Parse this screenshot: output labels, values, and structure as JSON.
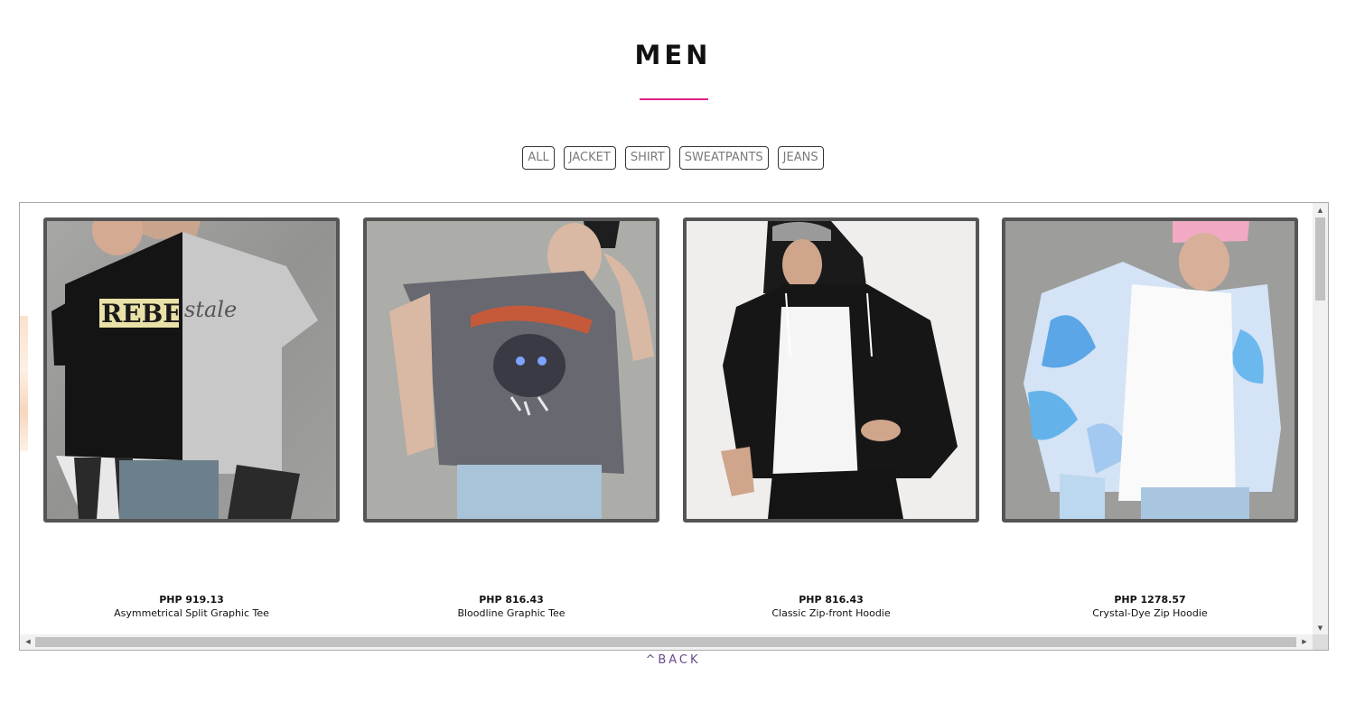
{
  "page": {
    "title": "MEN",
    "accent_color": "#e0218a"
  },
  "filters": [
    {
      "label": "ALL"
    },
    {
      "label": "JACKET"
    },
    {
      "label": "SHIRT"
    },
    {
      "label": "SWEATPANTS"
    },
    {
      "label": "JEANS"
    }
  ],
  "products": [
    {
      "price": "PHP 919.13",
      "name": "Asymmetrical Split Graphic Tee",
      "image": "split-graphic-tee-photo"
    },
    {
      "price": "PHP 816.43",
      "name": "Bloodline Graphic Tee",
      "image": "bloodline-graphic-tee-photo"
    },
    {
      "price": "PHP 816.43",
      "name": "Classic Zip-front Hoodie",
      "image": "zip-front-hoodie-photo"
    },
    {
      "price": "PHP 1278.57",
      "name": "Crystal-Dye Zip Hoodie",
      "image": "crystal-dye-hoodie-photo"
    }
  ],
  "scroll": {
    "up_icon": "arrow-up-icon",
    "down_icon": "arrow-down-icon",
    "left_icon": "arrow-left-icon",
    "right_icon": "arrow-right-icon"
  },
  "footer": {
    "back_label": "^BACK"
  }
}
